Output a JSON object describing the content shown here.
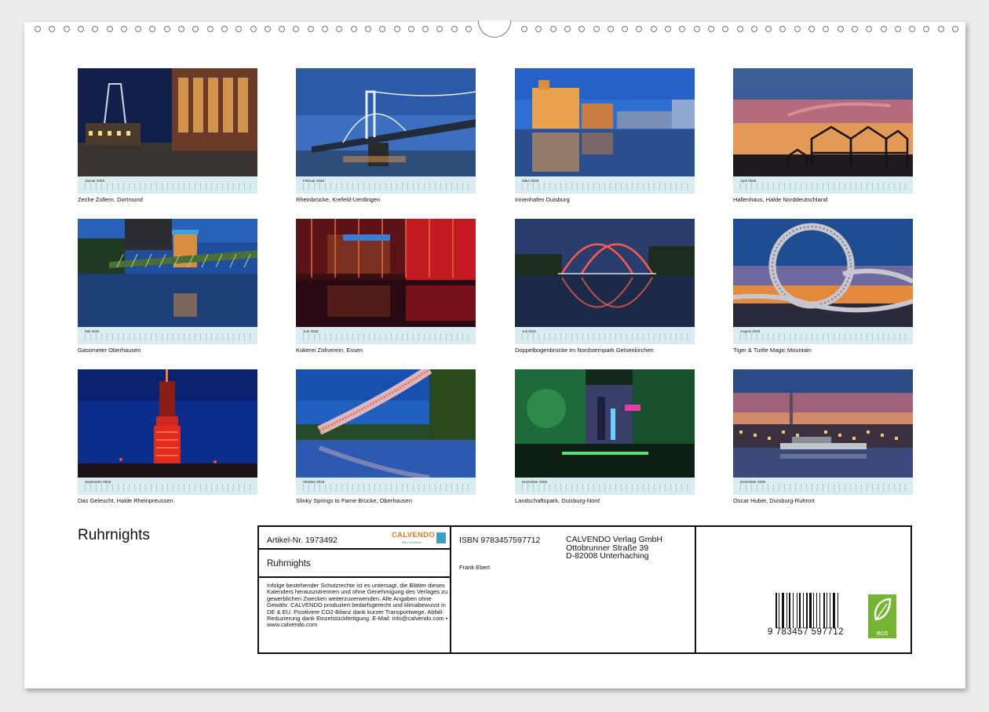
{
  "calendar": {
    "title": "Ruhrnights",
    "months": [
      {
        "label": "Januar 2026",
        "caption": "Zeche Zollern, Dortmund",
        "image": "illuminated-mine-headframe-night"
      },
      {
        "label": "Februar 2026",
        "caption": "Rheinbrücke, Krefeld-Uerdingen",
        "image": "bridge-blue-hour"
      },
      {
        "label": "März 2026",
        "caption": "Innenhafen Duisburg",
        "image": "harbour-reflection-dusk"
      },
      {
        "label": "April 2026",
        "caption": "Hallenhaus, Halde Norddeutschland",
        "image": "steel-frame-sunset"
      },
      {
        "label": "Mai 2026",
        "caption": "Gasometer Oberhausen",
        "image": "gasometer-bridge-reflection"
      },
      {
        "label": "Juni 2026",
        "caption": "Kokerei Zollverein, Essen",
        "image": "red-lit-coking-plant"
      },
      {
        "label": "Juli 2026",
        "caption": "Doppelbogenbrücke im Nordsternpark Gelsenkirchen",
        "image": "double-arch-bridge-red"
      },
      {
        "label": "August 2026",
        "caption": "Tiger & Turtle Magic Mountain",
        "image": "loop-sculpture-night"
      },
      {
        "label": "September 2026",
        "caption": "Das Geleucht, Halde Rheinpreussen",
        "image": "red-lamp-tower"
      },
      {
        "label": "Oktober 2026",
        "caption": "Slinky Springs to Fame Brücke, Oberhausen",
        "image": "spiral-bridge-canal"
      },
      {
        "label": "November 2026",
        "caption": "Landschaftspark, Duisburg-Nord",
        "image": "green-lit-blast-furnace"
      },
      {
        "label": "Dezember 2026",
        "caption": "Oscar Huber, Duisburg-Ruhrort",
        "image": "riverside-ship-dusk"
      }
    ]
  },
  "info": {
    "artikel": "Artikel-Nr. 1973492",
    "logo_text": "CALVENDO",
    "logo_sub": "Mein Kalender",
    "book_title": "Ruhrnights",
    "legal": "Infolge bestehender Schutzrechte ist es untersagt, die Blätter dieses Kalenders herauszutrennen und ohne Genehmigung des Verlages zu gewerblichen Zwecken weiterzuverwenden. Alle Angaben ohne Gewähr. CALVENDO produziert bedarfsgerecht und klimabewusst in DE & EU. Positivere CO2-Bilanz dank kurzer Transportwege. Abfall-Reduzierung dank Einzelstückfertigung. E-Mail: info@calvendo.com • www.calvendo.com",
    "isbn": "ISBN 9783457597712",
    "author": "Frank Ebert",
    "publisher_line1": "CALVENDO Verlag GmbH",
    "publisher_line2": "Ottobrunner Straße 39",
    "publisher_line3": "D-82008 Unterhaching",
    "barcode_number": "9 783457 597712",
    "eco_label": "eco"
  }
}
